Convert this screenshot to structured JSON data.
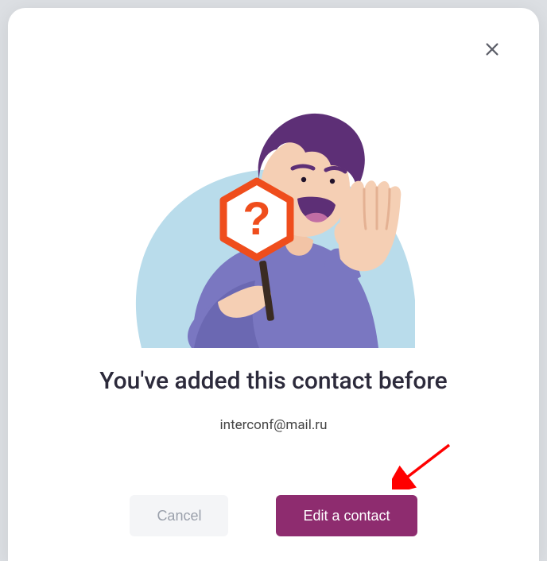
{
  "modal": {
    "title": "You've added this contact before",
    "email": "interconf@mail.ru",
    "cancel_label": "Cancel",
    "edit_label": "Edit a contact"
  },
  "colors": {
    "primary": "#8e2c6f",
    "cancel_bg": "#f4f5f7",
    "cancel_text": "#9aa0ab",
    "title_text": "#2c2a3b"
  },
  "annotation": {
    "arrow_color": "#ff0000"
  }
}
